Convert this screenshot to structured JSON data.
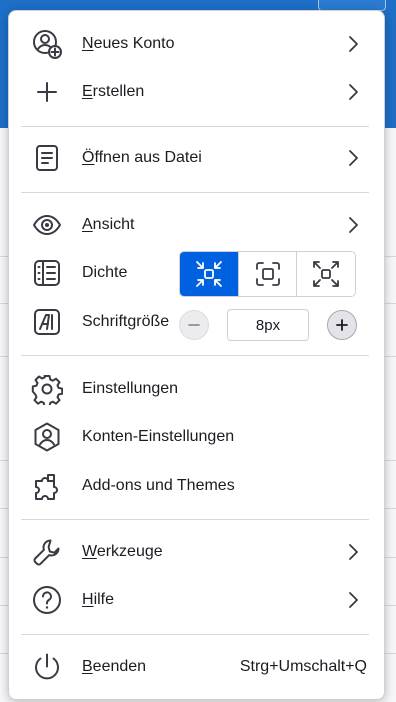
{
  "menu": {
    "new_account": {
      "label": "Neues Konto",
      "icon": "new-account-icon",
      "has_submenu": true
    },
    "create": {
      "label": "Erstellen",
      "icon": "plus-icon",
      "has_submenu": true
    },
    "open_file": {
      "label": "Öffnen aus Datei",
      "icon": "document-icon",
      "has_submenu": true
    },
    "view": {
      "label": "Ansicht",
      "icon": "eye-icon",
      "has_submenu": true
    },
    "density": {
      "label": "Dichte",
      "icon": "density-icon",
      "options": [
        {
          "name": "compact",
          "icon": "density-compact-icon",
          "selected": true
        },
        {
          "name": "normal",
          "icon": "density-normal-icon",
          "selected": false
        },
        {
          "name": "touch",
          "icon": "density-touch-icon",
          "selected": false
        }
      ]
    },
    "font_size": {
      "label": "Schriftgröße",
      "icon": "font-size-icon",
      "value": "8px",
      "decrease_icon": "minus-icon",
      "increase_icon": "plus-icon"
    },
    "settings": {
      "label": "Einstellungen",
      "icon": "gear-icon"
    },
    "account_settings": {
      "label": "Konten-Einstellungen",
      "icon": "account-shield-icon"
    },
    "addons": {
      "label": "Add-ons und Themes",
      "icon": "puzzle-icon"
    },
    "tools": {
      "label": "Werkzeuge",
      "icon": "wrench-icon",
      "has_submenu": true
    },
    "help": {
      "label": "Hilfe",
      "icon": "help-icon",
      "has_submenu": true
    },
    "quit": {
      "label": "Beenden",
      "icon": "power-icon",
      "shortcut": "Strg+Umschalt+Q"
    }
  },
  "colors": {
    "accent": "#0061e0",
    "icon": "#3a3944",
    "background_app_header": "#1e6fc7"
  }
}
